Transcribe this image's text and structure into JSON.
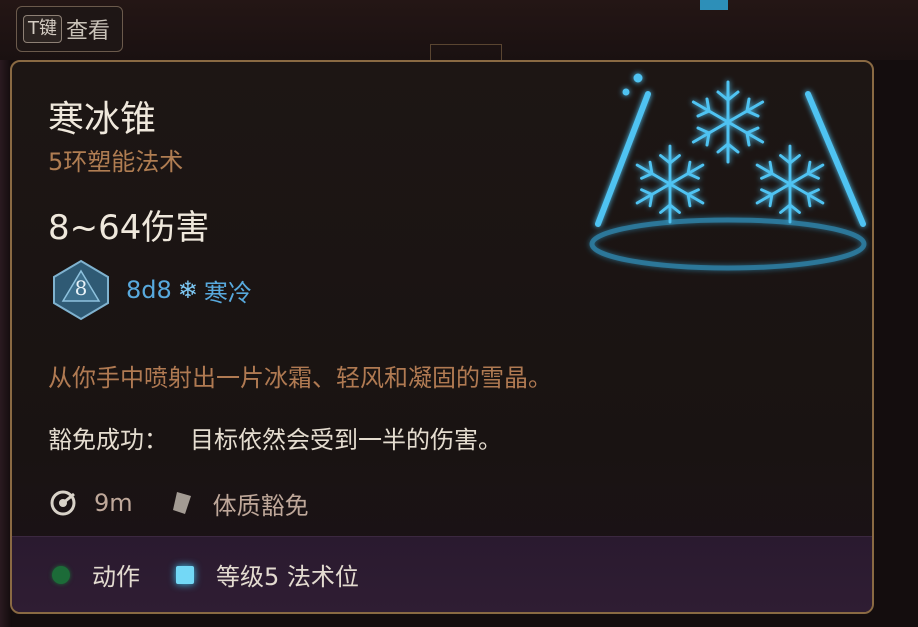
{
  "key_hint": {
    "key": "T键",
    "label": "查看"
  },
  "spell": {
    "name": "寒冰锥",
    "level_school": "5环塑能法术",
    "damage_range": "8~64伤害",
    "dice": {
      "die_face": "8",
      "roll": "8d8",
      "damage_type": "寒冷",
      "icon": "snowflake-icon"
    },
    "description": "从你手中喷射出一片冰霜、轻风和凝固的雪晶。",
    "save_label": "豁免成功：",
    "save_effect": "目标依然会受到一半的伤害。",
    "range": "9m",
    "save_type": "体质豁免"
  },
  "footer": {
    "action_label": "动作",
    "spell_slot_label": "等级5 法术位"
  },
  "colors": {
    "frame": "#8a6a43",
    "damage_blue": "#58a9dd",
    "description": "#b07a52",
    "action_dot": "#1c6b38",
    "spell_slot": "#73d8f6"
  }
}
